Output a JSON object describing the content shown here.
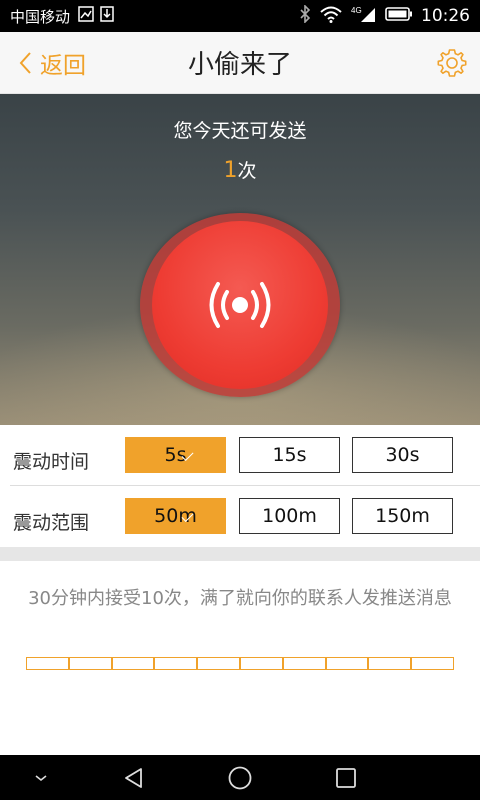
{
  "status_bar": {
    "carrier": "中国移动",
    "network": "4G",
    "time": "10:26"
  },
  "header": {
    "back_label": "返回",
    "title": "小偷来了"
  },
  "hero": {
    "remaining_label": "您今天还可发送",
    "remaining_count": "1",
    "remaining_unit": "次"
  },
  "vibration_time": {
    "label": "震动时间",
    "options": [
      "5s",
      "15s",
      "30s"
    ],
    "selected": "5s"
  },
  "vibration_range": {
    "label": "震动范围",
    "options": [
      "50m",
      "100m",
      "150m"
    ],
    "selected": "50m"
  },
  "info": {
    "text": "30分钟内接受10次，满了就向你的联系人发推送消息",
    "progress_total": 10,
    "progress_filled": 0
  },
  "colors": {
    "accent": "#f0a22b",
    "alarm_red": "#ee3c33"
  }
}
